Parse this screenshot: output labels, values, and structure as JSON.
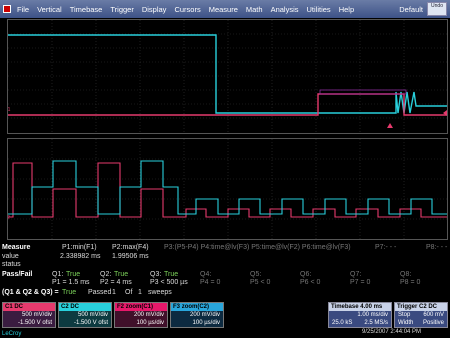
{
  "menu": {
    "items": [
      "File",
      "Vertical",
      "Timebase",
      "Trigger",
      "Display",
      "Cursors",
      "Measure",
      "Math",
      "Analysis",
      "Utilities",
      "Help"
    ],
    "default_label": "Default",
    "undo_label": "Undo"
  },
  "colors": {
    "cyan": "#29d0dc",
    "pink": "#e63a6d",
    "purple": "#8e2f9e",
    "math_pink": "#e6186a"
  },
  "markers": {
    "c1": "C1",
    "c2": "F2"
  },
  "measure": {
    "title": "Measure",
    "labels": [
      "value",
      "status"
    ],
    "params": [
      {
        "name": "P1:min(F1)",
        "value": "2.338982 ms"
      },
      {
        "name": "P2:max(F4)",
        "value": "1.99506 ms"
      },
      {
        "name": "P3:(P5-P4) P4:time@lv(F3) P5:time@lv(F2) P6:time@lv(F3)",
        "value": ""
      },
      {
        "name": "P7:- - -",
        "value": ""
      },
      {
        "name": "P8:- - -",
        "value": ""
      }
    ],
    "passfail": {
      "title": "Pass/Fail",
      "q": [
        {
          "name": "Q1:",
          "status": "True",
          "cond": "P1 = 1.5 ms"
        },
        {
          "name": "Q2:",
          "status": "True",
          "cond": "P2 = 4 ms"
        },
        {
          "name": "Q3:",
          "status": "True",
          "cond": "P3 < 500 µs"
        },
        {
          "name": "Q4:",
          "status": "",
          "cond": "P4 = 0"
        },
        {
          "name": "Q5:",
          "status": "",
          "cond": "P5 < 0"
        },
        {
          "name": "Q6:",
          "status": "",
          "cond": "P6 < 0"
        },
        {
          "name": "Q7:",
          "status": "",
          "cond": "P7 = 0"
        },
        {
          "name": "Q8:",
          "status": "",
          "cond": "P8 = 0"
        }
      ],
      "summary_label": "(Q1 & Q2 & Q3) =",
      "summary_value": "True",
      "passed": "Passed",
      "passed_count": "1",
      "of": "Of",
      "total": "1",
      "sweeps": "sweeps"
    }
  },
  "channels": [
    {
      "hdr": "C1",
      "tag": "DC",
      "line1": "500 mV/div",
      "line2": "-1.500 V ofst",
      "color": "#e63a6d"
    },
    {
      "hdr": "C2",
      "tag": "DC",
      "line1": "500 mV/div",
      "line2": "-1.500 V ofst",
      "color": "#29d0dc"
    },
    {
      "hdr": "F2",
      "tag": "zoom(C1)",
      "line1": "200 mV/div",
      "line2": "100 µs/div",
      "color": "#e6186a"
    },
    {
      "hdr": "F3",
      "tag": "zoom(C2)",
      "line1": "200 mV/div",
      "line2": "100 µs/div",
      "color": "#29a6dc"
    }
  ],
  "timebase": {
    "label": "Timebase",
    "value": "4.00 ms",
    "line1": "1.00 ms/div",
    "s1": "25.0 kS",
    "s2": "2.5 MS/s"
  },
  "trigger": {
    "label": "Trigger",
    "tag": "C2 DC",
    "mode": "Stop",
    "level": "600 mV",
    "type": "Width",
    "slope": "Positive"
  },
  "datetime": "9/25/2007 2:44:04 PM",
  "brand": "LeCroy"
}
